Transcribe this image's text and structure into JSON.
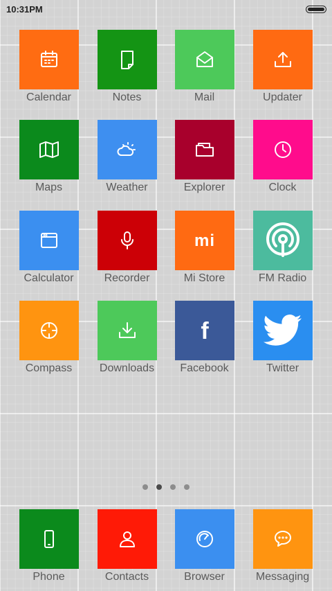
{
  "status_bar": {
    "time": "10:31PM"
  },
  "apps": [
    {
      "label": "Calendar",
      "color": "#ff6c12",
      "icon": "calendar-icon"
    },
    {
      "label": "Notes",
      "color": "#149414",
      "icon": "notes-icon"
    },
    {
      "label": "Mail",
      "color": "#4dc95a",
      "icon": "mail-icon"
    },
    {
      "label": "Updater",
      "color": "#ff6a12",
      "icon": "upload-icon"
    },
    {
      "label": "Maps",
      "color": "#0b8a1c",
      "icon": "map-icon"
    },
    {
      "label": "Weather",
      "color": "#3e8ff0",
      "icon": "weather-icon"
    },
    {
      "label": "Explorer",
      "color": "#a8002c",
      "icon": "folder-icon"
    },
    {
      "label": "Clock",
      "color": "#ff0c8c",
      "icon": "clock-icon"
    },
    {
      "label": "Calculator",
      "color": "#3b8ff0",
      "icon": "calculator-icon"
    },
    {
      "label": "Recorder",
      "color": "#cc0006",
      "icon": "microphone-icon"
    },
    {
      "label": "Mi Store",
      "color": "#ff6a12",
      "icon": "mi-logo-icon",
      "icon_text": "mi"
    },
    {
      "label": "FM Radio",
      "color": "#4cbb9e",
      "icon": "radio-icon"
    },
    {
      "label": "Compass",
      "color": "#ff9410",
      "icon": "compass-icon"
    },
    {
      "label": "Downloads",
      "color": "#4dc95a",
      "icon": "download-icon"
    },
    {
      "label": "Facebook",
      "color": "#3b5998",
      "icon": "facebook-icon",
      "icon_text": "f"
    },
    {
      "label": "Twitter",
      "color": "#2a8ef0",
      "icon": "twitter-icon"
    }
  ],
  "page_indicator": {
    "pages": 4,
    "current": 2
  },
  "dock": [
    {
      "label": "Phone",
      "color": "#0b8a1c",
      "icon": "phone-icon"
    },
    {
      "label": "Contacts",
      "color": "#ff1a06",
      "icon": "contacts-icon"
    },
    {
      "label": "Browser",
      "color": "#3b8ff0",
      "icon": "browser-icon"
    },
    {
      "label": "Messaging",
      "color": "#ff9410",
      "icon": "messaging-icon"
    }
  ]
}
